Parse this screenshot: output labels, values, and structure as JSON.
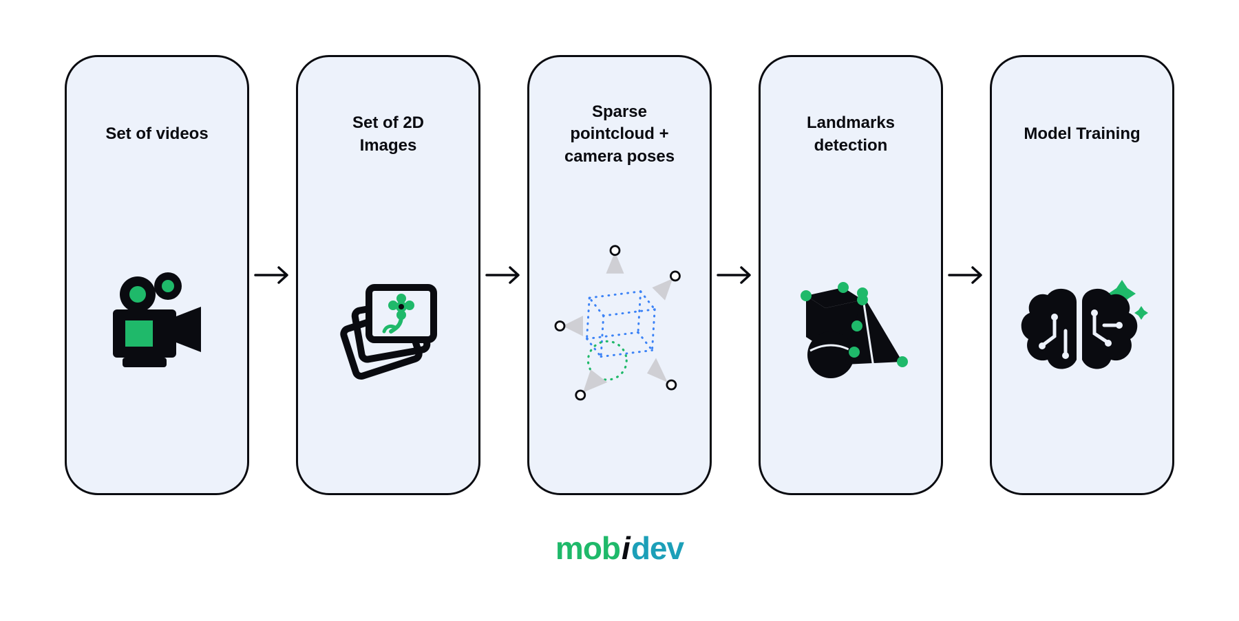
{
  "steps": [
    {
      "id": "videos",
      "label": "Set of videos"
    },
    {
      "id": "images2d",
      "label": "Set of 2D\nImages"
    },
    {
      "id": "pointcloud",
      "label": "Sparse\npointcloud +\ncamera poses"
    },
    {
      "id": "landmarks",
      "label": "Landmarks\ndetection"
    },
    {
      "id": "training",
      "label": "Model Training"
    }
  ],
  "brand": {
    "a": "mob",
    "b": "i",
    "c": "dev"
  },
  "colors": {
    "accent": "#1fb96a",
    "ink": "#0a0b10",
    "card": "#edf2fb",
    "blue": "#3b82f6",
    "teal": "#1c9fb8"
  }
}
